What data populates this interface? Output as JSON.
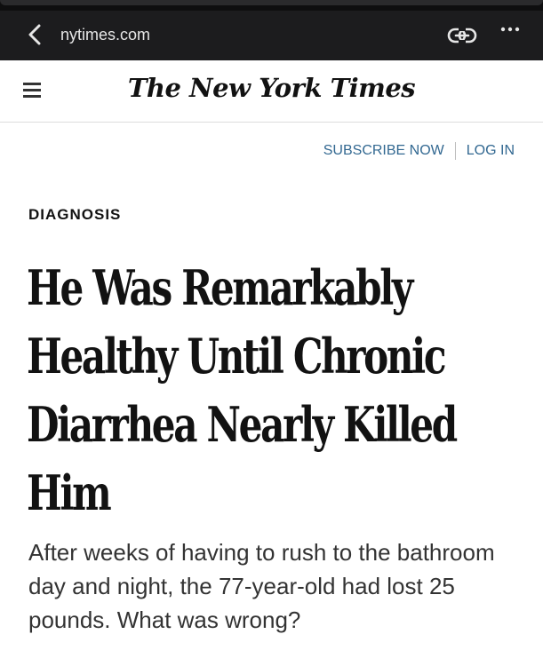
{
  "browser": {
    "url": "nytimes.com",
    "icons": [
      "back-chevron-icon",
      "link-icon",
      "more-dots-icon"
    ]
  },
  "header": {
    "logo_text": "The New York Times",
    "menu_icon": "hamburger-menu-icon"
  },
  "auth": {
    "subscribe_label": "SUBSCRIBE NOW",
    "login_label": "LOG IN",
    "link_color": "#326891"
  },
  "article": {
    "kicker": "DIAGNOSIS",
    "headline": "He Was Remarkably Healthy Until Chronic Diarrhea Nearly Killed Him",
    "summary": "After weeks of having to rush to the bathroom day and night, the 77-year-old had lost 25 pounds. What was wrong?"
  }
}
